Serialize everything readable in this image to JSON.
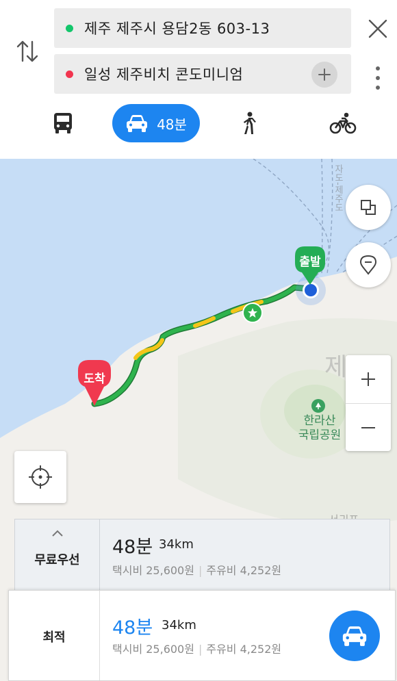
{
  "search": {
    "origin": "제주 제주시 용담2동 603-13",
    "destination": "일성 제주비치 콘도미니엄"
  },
  "icons": {
    "swap": "swap-vertical-icon",
    "close": "close-icon",
    "add": "plus-icon",
    "more": "more-vertical-icon"
  },
  "modes": {
    "bus": "bus-icon",
    "car_time": "48분",
    "walk": "walk-icon",
    "bike": "bike-icon",
    "active_color": "#1d85f0"
  },
  "map": {
    "start_label": "출발",
    "end_label": "도착",
    "park_name_line1": "한라산",
    "park_name_line2": "국립공원",
    "region_big": "제",
    "region_bottom": "서귀포",
    "ferry_label": "자도-제주도",
    "route_colors": {
      "green": "#2fb34e",
      "yellow": "#f4c519"
    }
  },
  "routes": [
    {
      "label": "무료우선",
      "time": "48분",
      "distance": "34km",
      "taxi": "택시비 25,600원",
      "fuel": "주유비 4,252원"
    },
    {
      "label": "최적",
      "time": "48분",
      "distance": "34km",
      "taxi": "택시비 25,600원",
      "fuel": "주유비 4,252원"
    }
  ]
}
